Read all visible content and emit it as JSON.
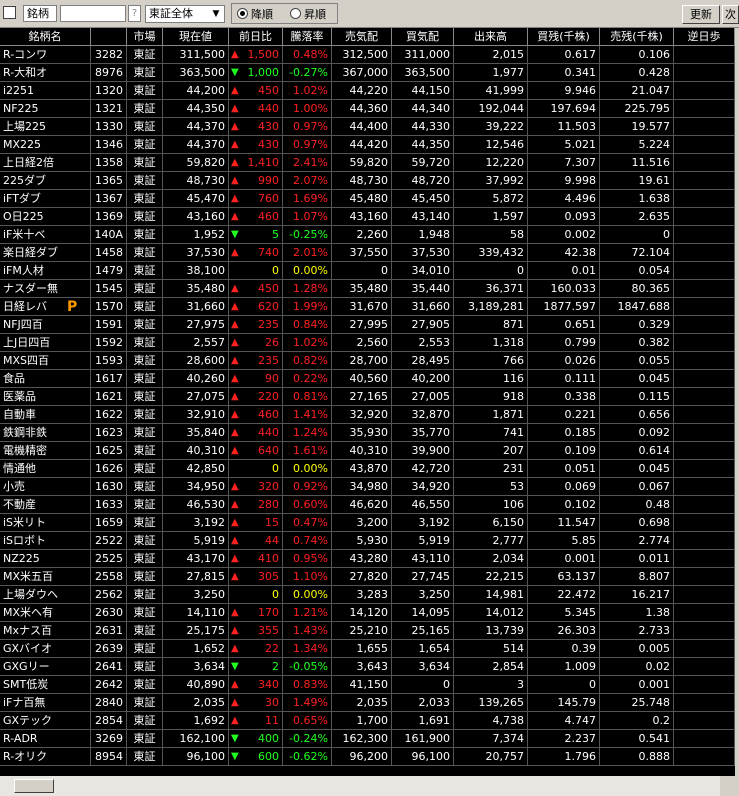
{
  "toolbar": {
    "field_label": "銘柄",
    "help": "?",
    "market_select": "東証全体",
    "sort_desc": "降順",
    "sort_asc": "昇順",
    "refresh": "更新",
    "other": "次"
  },
  "columns": [
    "銘柄名",
    "",
    "市場",
    "現在値",
    "前日比",
    "騰落率",
    "売気配",
    "買気配",
    "出来高",
    "買残(千株)",
    "売残(千株)",
    "逆日歩"
  ],
  "rows": [
    {
      "name": "R-コンワ",
      "code": "3282",
      "mkt": "東証",
      "price": "311,500",
      "dir": "up",
      "chg": "1,500",
      "pct": "0.48%",
      "ask": "312,500",
      "bid": "311,000",
      "vol": "2,015",
      "buy": "0.617",
      "sell": "0.106",
      "extra": ""
    },
    {
      "name": "R-大和オ",
      "code": "8976",
      "mkt": "東証",
      "price": "363,500",
      "dir": "down",
      "chg": "1,000",
      "pct": "-0.27%",
      "ask": "367,000",
      "bid": "363,500",
      "vol": "1,977",
      "buy": "0.341",
      "sell": "0.428",
      "extra": ""
    },
    {
      "name": "i2251",
      "code": "1320",
      "mkt": "東証",
      "price": "44,200",
      "dir": "up",
      "chg": "450",
      "pct": "1.02%",
      "ask": "44,220",
      "bid": "44,150",
      "vol": "41,999",
      "buy": "9.946",
      "sell": "21.047",
      "extra": ""
    },
    {
      "name": "NF225",
      "code": "1321",
      "mkt": "東証",
      "price": "44,350",
      "dir": "up",
      "chg": "440",
      "pct": "1.00%",
      "ask": "44,360",
      "bid": "44,340",
      "vol": "192,044",
      "buy": "197.694",
      "sell": "225.795",
      "extra": ""
    },
    {
      "name": "上場225",
      "code": "1330",
      "mkt": "東証",
      "price": "44,370",
      "dir": "up",
      "chg": "430",
      "pct": "0.97%",
      "ask": "44,400",
      "bid": "44,330",
      "vol": "39,222",
      "buy": "11.503",
      "sell": "19.577",
      "extra": ""
    },
    {
      "name": "MX225",
      "code": "1346",
      "mkt": "東証",
      "price": "44,370",
      "dir": "up",
      "chg": "430",
      "pct": "0.97%",
      "ask": "44,420",
      "bid": "44,350",
      "vol": "12,546",
      "buy": "5.021",
      "sell": "5.224",
      "extra": ""
    },
    {
      "name": "上日経2倍",
      "code": "1358",
      "mkt": "東証",
      "price": "59,820",
      "dir": "up",
      "chg": "1,410",
      "pct": "2.41%",
      "ask": "59,820",
      "bid": "59,720",
      "vol": "12,220",
      "buy": "7.307",
      "sell": "11.516",
      "extra": ""
    },
    {
      "name": "225ダブ",
      "code": "1365",
      "mkt": "東証",
      "price": "48,730",
      "dir": "up",
      "chg": "990",
      "pct": "2.07%",
      "ask": "48,730",
      "bid": "48,720",
      "vol": "37,992",
      "buy": "9.998",
      "sell": "19.61",
      "extra": ""
    },
    {
      "name": "iFTダブ",
      "code": "1367",
      "mkt": "東証",
      "price": "45,470",
      "dir": "up",
      "chg": "760",
      "pct": "1.69%",
      "ask": "45,480",
      "bid": "45,450",
      "vol": "5,872",
      "buy": "4.496",
      "sell": "1.638",
      "extra": ""
    },
    {
      "name": "O日225",
      "code": "1369",
      "mkt": "東証",
      "price": "43,160",
      "dir": "up",
      "chg": "460",
      "pct": "1.07%",
      "ask": "43,160",
      "bid": "43,140",
      "vol": "1,597",
      "buy": "0.093",
      "sell": "2.635",
      "extra": ""
    },
    {
      "name": "iF米十ベ",
      "code": "140A",
      "mkt": "東証",
      "price": "1,952",
      "dir": "down",
      "chg": "5",
      "pct": "-0.25%",
      "ask": "2,260",
      "bid": "1,948",
      "vol": "58",
      "buy": "0.002",
      "sell": "0",
      "extra": ""
    },
    {
      "name": "楽日経ダブ",
      "code": "1458",
      "mkt": "東証",
      "price": "37,530",
      "dir": "up",
      "chg": "740",
      "pct": "2.01%",
      "ask": "37,550",
      "bid": "37,530",
      "vol": "339,432",
      "buy": "42.38",
      "sell": "72.104",
      "extra": ""
    },
    {
      "name": "iFM人材",
      "code": "1479",
      "mkt": "東証",
      "price": "38,100",
      "dir": "none",
      "chg": "0",
      "pct": "0.00%",
      "ask": "0",
      "bid": "34,010",
      "vol": "0",
      "buy": "0.01",
      "sell": "0.054",
      "extra": ""
    },
    {
      "name": "ナスダー無",
      "code": "1545",
      "mkt": "東証",
      "price": "35,480",
      "dir": "up",
      "chg": "450",
      "pct": "1.28%",
      "ask": "35,480",
      "bid": "35,440",
      "vol": "36,371",
      "buy": "160.033",
      "sell": "80.365",
      "extra": ""
    },
    {
      "name": "日経レバ",
      "code": "1570",
      "mkt": "東証",
      "price": "31,660",
      "dir": "up",
      "chg": "620",
      "pct": "1.99%",
      "ask": "31,670",
      "bid": "31,660",
      "vol": "3,189,281",
      "buy": "1877.597",
      "sell": "1847.688",
      "extra": "",
      "mark": "P"
    },
    {
      "name": "NFJ四百",
      "code": "1591",
      "mkt": "東証",
      "price": "27,975",
      "dir": "up",
      "chg": "235",
      "pct": "0.84%",
      "ask": "27,995",
      "bid": "27,905",
      "vol": "871",
      "buy": "0.651",
      "sell": "0.329",
      "extra": ""
    },
    {
      "name": "上J日四百",
      "code": "1592",
      "mkt": "東証",
      "price": "2,557",
      "dir": "up",
      "chg": "26",
      "pct": "1.02%",
      "ask": "2,560",
      "bid": "2,553",
      "vol": "1,318",
      "buy": "0.799",
      "sell": "0.382",
      "extra": ""
    },
    {
      "name": "MXS四百",
      "code": "1593",
      "mkt": "東証",
      "price": "28,600",
      "dir": "up",
      "chg": "235",
      "pct": "0.82%",
      "ask": "28,700",
      "bid": "28,495",
      "vol": "766",
      "buy": "0.026",
      "sell": "0.055",
      "extra": ""
    },
    {
      "name": "食品",
      "code": "1617",
      "mkt": "東証",
      "price": "40,260",
      "dir": "up",
      "chg": "90",
      "pct": "0.22%",
      "ask": "40,560",
      "bid": "40,200",
      "vol": "116",
      "buy": "0.111",
      "sell": "0.045",
      "extra": ""
    },
    {
      "name": "医薬品",
      "code": "1621",
      "mkt": "東証",
      "price": "27,075",
      "dir": "up",
      "chg": "220",
      "pct": "0.81%",
      "ask": "27,165",
      "bid": "27,005",
      "vol": "918",
      "buy": "0.338",
      "sell": "0.115",
      "extra": ""
    },
    {
      "name": "自動車",
      "code": "1622",
      "mkt": "東証",
      "price": "32,910",
      "dir": "up",
      "chg": "460",
      "pct": "1.41%",
      "ask": "32,920",
      "bid": "32,870",
      "vol": "1,871",
      "buy": "0.221",
      "sell": "0.656",
      "extra": ""
    },
    {
      "name": "鉄鋼非鉄",
      "code": "1623",
      "mkt": "東証",
      "price": "35,840",
      "dir": "up",
      "chg": "440",
      "pct": "1.24%",
      "ask": "35,930",
      "bid": "35,770",
      "vol": "741",
      "buy": "0.185",
      "sell": "0.092",
      "extra": ""
    },
    {
      "name": "電機精密",
      "code": "1625",
      "mkt": "東証",
      "price": "40,310",
      "dir": "up",
      "chg": "640",
      "pct": "1.61%",
      "ask": "40,310",
      "bid": "39,900",
      "vol": "207",
      "buy": "0.109",
      "sell": "0.614",
      "extra": ""
    },
    {
      "name": "情通他",
      "code": "1626",
      "mkt": "東証",
      "price": "42,850",
      "dir": "none",
      "chg": "0",
      "pct": "0.00%",
      "ask": "43,870",
      "bid": "42,720",
      "vol": "231",
      "buy": "0.051",
      "sell": "0.045",
      "extra": ""
    },
    {
      "name": "小売",
      "code": "1630",
      "mkt": "東証",
      "price": "34,950",
      "dir": "up",
      "chg": "320",
      "pct": "0.92%",
      "ask": "34,980",
      "bid": "34,920",
      "vol": "53",
      "buy": "0.069",
      "sell": "0.067",
      "extra": ""
    },
    {
      "name": "不動産",
      "code": "1633",
      "mkt": "東証",
      "price": "46,530",
      "dir": "up",
      "chg": "280",
      "pct": "0.60%",
      "ask": "46,620",
      "bid": "46,550",
      "vol": "106",
      "buy": "0.102",
      "sell": "0.48",
      "extra": ""
    },
    {
      "name": "iS米リト",
      "code": "1659",
      "mkt": "東証",
      "price": "3,192",
      "dir": "up",
      "chg": "15",
      "pct": "0.47%",
      "ask": "3,200",
      "bid": "3,192",
      "vol": "6,150",
      "buy": "11.547",
      "sell": "0.698",
      "extra": ""
    },
    {
      "name": "iSロボト",
      "code": "2522",
      "mkt": "東証",
      "price": "5,919",
      "dir": "up",
      "chg": "44",
      "pct": "0.74%",
      "ask": "5,930",
      "bid": "5,919",
      "vol": "2,777",
      "buy": "5.85",
      "sell": "2.774",
      "extra": ""
    },
    {
      "name": "NZ225",
      "code": "2525",
      "mkt": "東証",
      "price": "43,170",
      "dir": "up",
      "chg": "410",
      "pct": "0.95%",
      "ask": "43,280",
      "bid": "43,110",
      "vol": "2,034",
      "buy": "0.001",
      "sell": "0.011",
      "extra": ""
    },
    {
      "name": "MX米五百",
      "code": "2558",
      "mkt": "東証",
      "price": "27,815",
      "dir": "up",
      "chg": "305",
      "pct": "1.10%",
      "ask": "27,820",
      "bid": "27,745",
      "vol": "22,215",
      "buy": "63.137",
      "sell": "8.807",
      "extra": ""
    },
    {
      "name": "上場ダウヘ",
      "code": "2562",
      "mkt": "東証",
      "price": "3,250",
      "dir": "none",
      "chg": "0",
      "pct": "0.00%",
      "ask": "3,283",
      "bid": "3,250",
      "vol": "14,981",
      "buy": "22.472",
      "sell": "16.217",
      "extra": ""
    },
    {
      "name": "MX米ヘ有",
      "code": "2630",
      "mkt": "東証",
      "price": "14,110",
      "dir": "up",
      "chg": "170",
      "pct": "1.21%",
      "ask": "14,120",
      "bid": "14,095",
      "vol": "14,012",
      "buy": "5.345",
      "sell": "1.38",
      "extra": ""
    },
    {
      "name": "Mxナス百",
      "code": "2631",
      "mkt": "東証",
      "price": "25,175",
      "dir": "up",
      "chg": "355",
      "pct": "1.43%",
      "ask": "25,210",
      "bid": "25,165",
      "vol": "13,739",
      "buy": "26.303",
      "sell": "2.733",
      "extra": ""
    },
    {
      "name": "GXバイオ",
      "code": "2639",
      "mkt": "東証",
      "price": "1,652",
      "dir": "up",
      "chg": "22",
      "pct": "1.34%",
      "ask": "1,655",
      "bid": "1,654",
      "vol": "514",
      "buy": "0.39",
      "sell": "0.005",
      "extra": ""
    },
    {
      "name": "GXGリー",
      "code": "2641",
      "mkt": "東証",
      "price": "3,634",
      "dir": "down",
      "chg": "2",
      "pct": "-0.05%",
      "ask": "3,643",
      "bid": "3,634",
      "vol": "2,854",
      "buy": "1.009",
      "sell": "0.02",
      "extra": ""
    },
    {
      "name": "SMT低炭",
      "code": "2642",
      "mkt": "東証",
      "price": "40,890",
      "dir": "up",
      "chg": "340",
      "pct": "0.83%",
      "ask": "41,150",
      "bid": "0",
      "vol": "3",
      "buy": "0",
      "sell": "0.001",
      "extra": ""
    },
    {
      "name": "iFナ百無",
      "code": "2840",
      "mkt": "東証",
      "price": "2,035",
      "dir": "up",
      "chg": "30",
      "pct": "1.49%",
      "ask": "2,035",
      "bid": "2,033",
      "vol": "139,265",
      "buy": "145.79",
      "sell": "25.748",
      "extra": ""
    },
    {
      "name": "GXテック",
      "code": "2854",
      "mkt": "東証",
      "price": "1,692",
      "dir": "up",
      "chg": "11",
      "pct": "0.65%",
      "ask": "1,700",
      "bid": "1,691",
      "vol": "4,738",
      "buy": "4.747",
      "sell": "0.2",
      "extra": ""
    },
    {
      "name": "R-ADR",
      "code": "3269",
      "mkt": "東証",
      "price": "162,100",
      "dir": "down",
      "chg": "400",
      "pct": "-0.24%",
      "ask": "162,300",
      "bid": "161,900",
      "vol": "7,374",
      "buy": "2.237",
      "sell": "0.541",
      "extra": ""
    },
    {
      "name": "R-オリク",
      "code": "8954",
      "mkt": "東証",
      "price": "96,100",
      "dir": "down",
      "chg": "600",
      "pct": "-0.62%",
      "ask": "96,200",
      "bid": "96,100",
      "vol": "20,757",
      "buy": "1.796",
      "sell": "0.888",
      "extra": ""
    }
  ]
}
